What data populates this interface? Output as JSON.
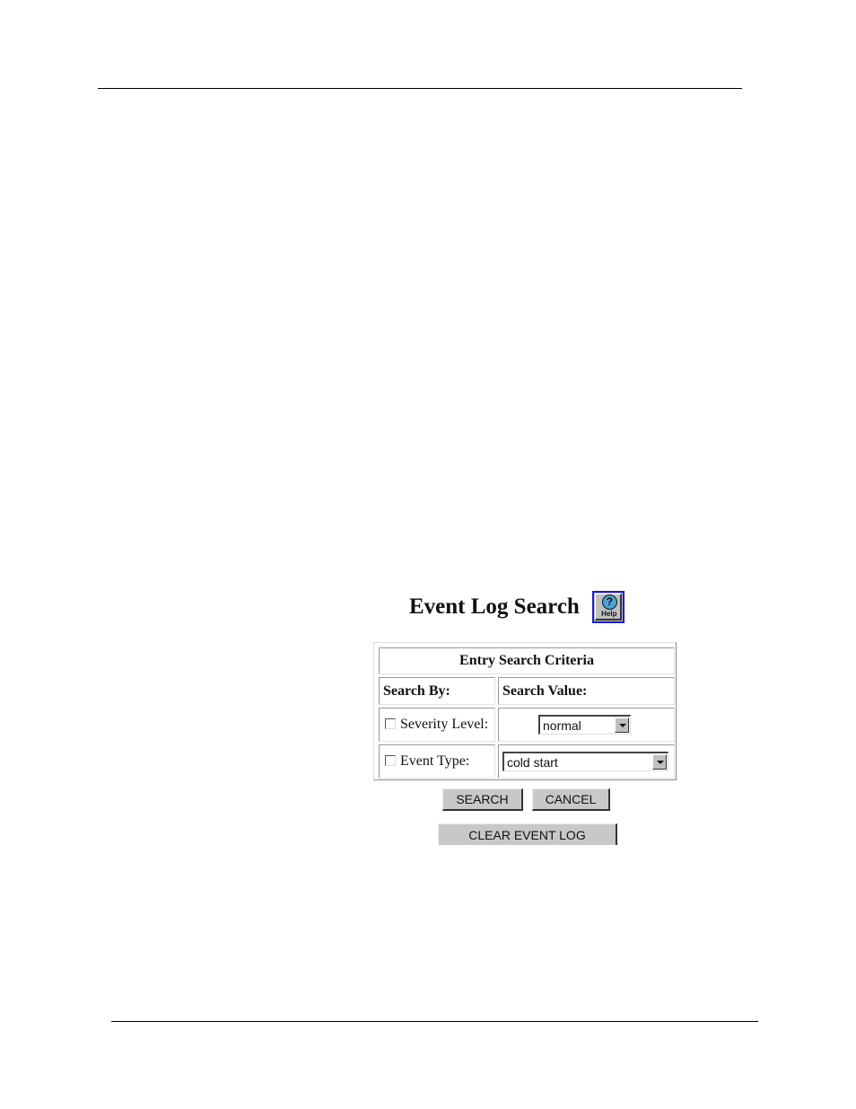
{
  "page": {
    "title": "Event Log Search",
    "help_button": {
      "icon": "help-icon",
      "label": "Help"
    }
  },
  "criteria_table": {
    "heading": "Entry Search Criteria",
    "columns": [
      "Search By:",
      "Search Value:"
    ],
    "rows": [
      {
        "checked": false,
        "label": "Severity Level:",
        "control": "select",
        "value": "normal"
      },
      {
        "checked": false,
        "label": "Event Type:",
        "control": "select",
        "value": "cold start"
      }
    ]
  },
  "buttons": {
    "search": "SEARCH",
    "cancel": "CANCEL",
    "clear": "CLEAR EVENT LOG"
  }
}
